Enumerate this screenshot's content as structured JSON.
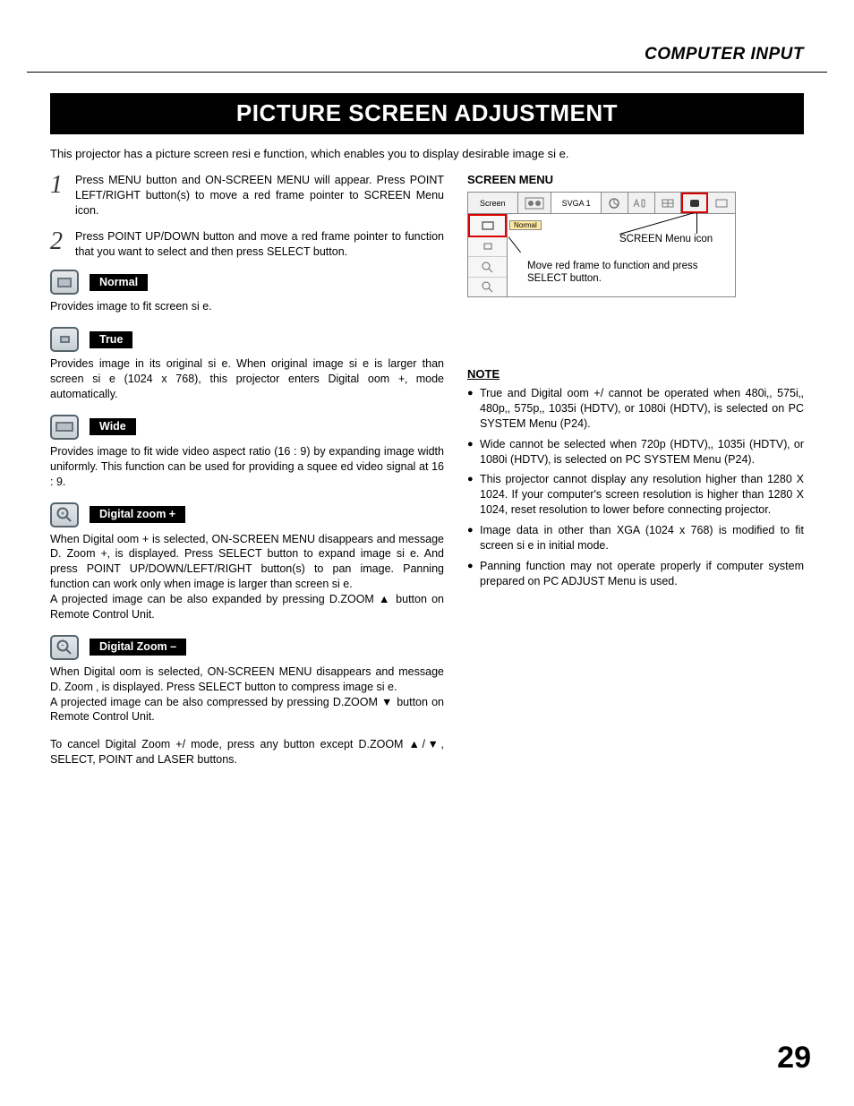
{
  "header": "COMPUTER INPUT",
  "title": "PICTURE SCREEN ADJUSTMENT",
  "intro": "This projector has a picture screen resi e function, which enables you to display desirable image si e.",
  "steps": [
    {
      "num": "1",
      "text": "Press MENU button and ON-SCREEN MENU will appear.  Press POINT LEFT/RIGHT button(s) to move a red frame pointer to SCREEN Menu icon."
    },
    {
      "num": "2",
      "text": "Press POINT UP/DOWN button and move a red frame pointer to function that you want to select and then press SELECT button."
    }
  ],
  "modes": {
    "normal": {
      "label": "Normal",
      "desc": "Provides image to fit screen si e."
    },
    "true": {
      "label": "True",
      "desc": "Provides image in its original si e.  When original image si e is larger than screen si e (1024 x 768), this projector enters  Digital  oom +‚ mode automatically."
    },
    "wide": {
      "label": "Wide",
      "desc": "Provides image to fit wide video aspect ratio (16 : 9) by expanding image width uniformly.  This function can be used for providing a squee ed video signal at 16 : 9."
    },
    "dzplus": {
      "label": "Digital zoom +",
      "desc": "When Digital  oom + is selected, ON-SCREEN MENU disappears and message  D. Zoom +‚ is displayed.  Press SELECT button to expand image si e.  And press POINT UP/DOWN/LEFT/RIGHT button(s) to pan image.  Panning function can work only when image is larger than screen si e.",
      "desc2": "A projected image can be also expanded by pressing D.ZOOM ▲ button on Remote Control Unit."
    },
    "dzminus": {
      "label": "Digital Zoom –",
      "desc": "When Digital  oom   is selected, ON-SCREEN MENU disappears and message  D. Zoom  ‚ is displayed.  Press SELECT button to compress image si e.",
      "desc2": "A projected image can be also compressed by pressing D.ZOOM ▼ button on Remote Control Unit."
    }
  },
  "cancel_text": "To cancel Digital Zoom +/  mode, press any button except D.ZOOM ▲/▼, SELECT, POINT and LASER buttons.",
  "right": {
    "heading": "SCREEN MENU",
    "menu_label_screen": "Screen",
    "menu_label_svga": "SVGA 1",
    "normal_tag": "Normal",
    "callout_icon": "SCREEN Menu icon",
    "callout_move": "Move red frame to function and press SELECT button.",
    "note_header": "NOTE",
    "notes": [
      "True and Digital  oom +/  cannot be operated when  480i‚,  575i‚,  480p‚,  575p‚,  1035i (HDTV)‚ or  1080i (HDTV)‚ is selected on PC SYSTEM Menu  (P24).",
      "Wide cannot be selected when  720p (HDTV)‚,  1035i (HDTV)‚ or  1080i (HDTV)‚ is selected on PC SYSTEM Menu  (P24).",
      "This projector cannot display any resolution higher than 1280 X 1024.  If your computer's screen resolution is higher than 1280 X 1024, reset resolution to lower before connecting projector.",
      "Image data in other than XGA (1024 x 768) is modified to fit screen si e in initial mode.",
      "Panning function may not operate properly if computer system prepared on PC ADJUST Menu is used."
    ]
  },
  "page_number": "29"
}
